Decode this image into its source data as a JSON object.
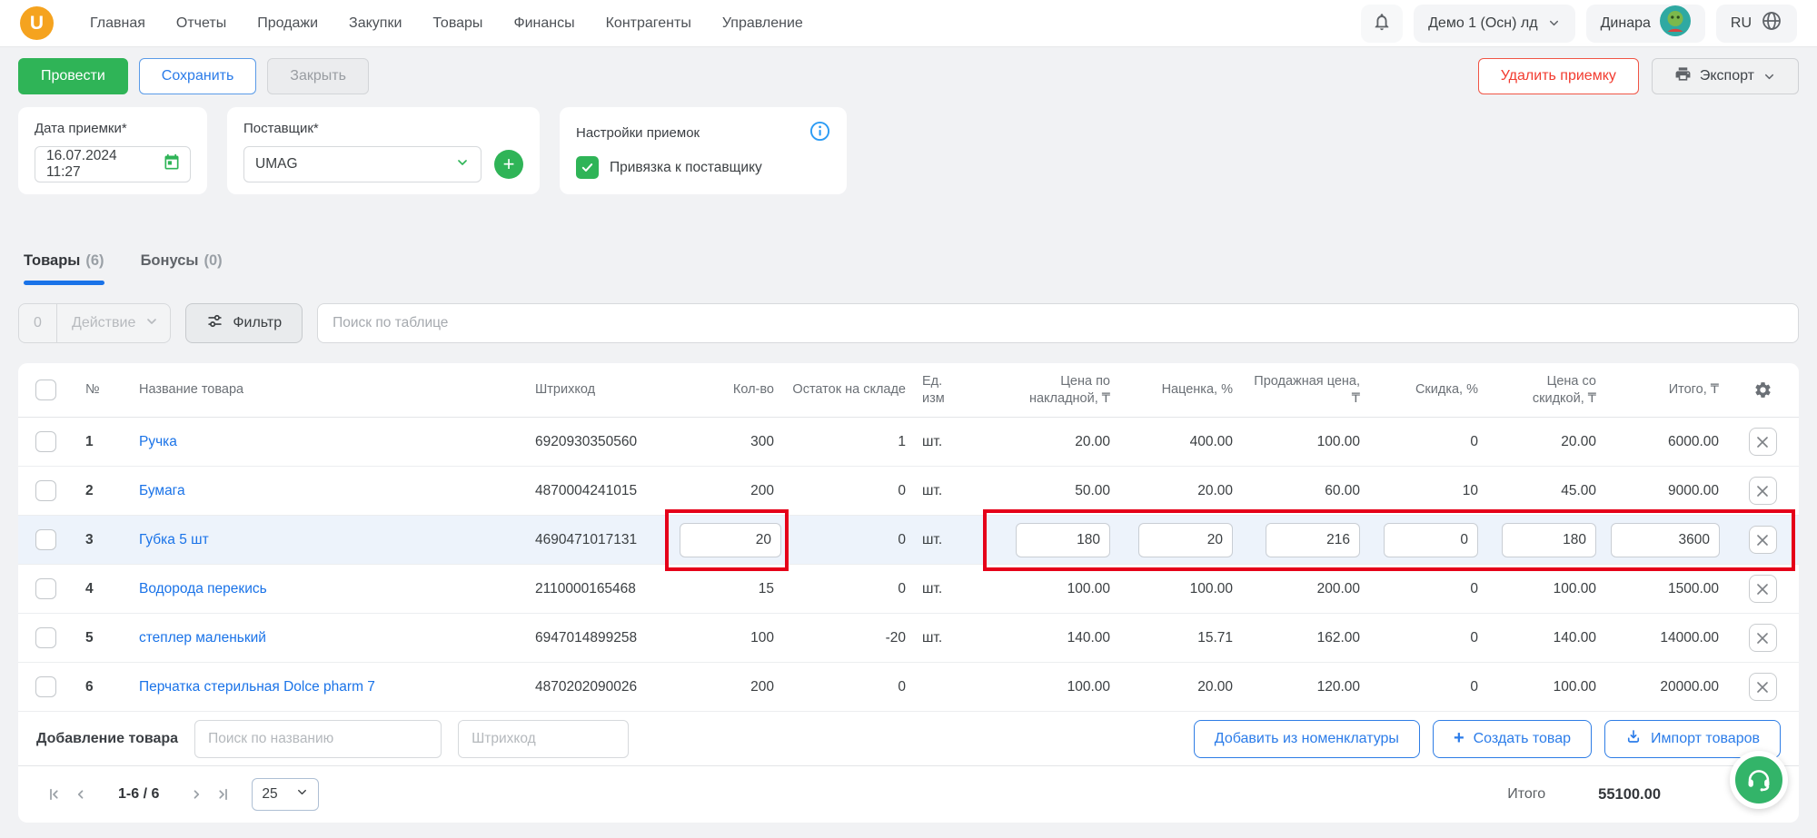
{
  "header": {
    "logo_letter": "U",
    "nav_items": [
      "Главная",
      "Отчеты",
      "Продажи",
      "Закупки",
      "Товары",
      "Финансы",
      "Контрагенты",
      "Управление"
    ],
    "company_selector": "Демо 1 (Осн) лд",
    "user_name": "Динара",
    "language": "RU"
  },
  "action_bar": {
    "post": "Провести",
    "save": "Сохранить",
    "close": "Закрыть",
    "delete": "Удалить приемку",
    "export": "Экспорт"
  },
  "form": {
    "date_label": "Дата приемки*",
    "date_value": "16.07.2024 11:27",
    "supplier_label": "Поставщик*",
    "supplier_value": "UMAG",
    "settings_label": "Настройки приемок",
    "settings_checkbox_label": "Привязка к поставщику",
    "settings_checkbox_checked": true
  },
  "tabs": [
    {
      "label": "Товары",
      "count": "(6)",
      "active": true
    },
    {
      "label": "Бонусы",
      "count": "(0)",
      "active": false
    }
  ],
  "toolbar": {
    "selected_count": "0",
    "action_label": "Действие",
    "filter_label": "Фильтр",
    "search_placeholder": "Поиск по таблице"
  },
  "table": {
    "headers": {
      "num": "№",
      "name": "Название товара",
      "barcode": "Штрихкод",
      "qty": "Кол-во",
      "stock": "Остаток на складе",
      "unit": "Ед. изм",
      "price_invoice": "Цена по накладной, ₸",
      "markup": "Наценка, %",
      "sale_price": "Продажная цена, ₸",
      "discount": "Скидка, %",
      "price_discounted": "Цена со скидкой, ₸",
      "total": "Итого, ₸"
    },
    "rows": [
      {
        "num": "1",
        "name": "Ручка",
        "barcode": "6920930350560",
        "qty": "300",
        "stock": "1",
        "unit": "шт.",
        "price_invoice": "20.00",
        "markup": "400.00",
        "sale_price": "100.00",
        "discount": "0",
        "price_discounted": "20.00",
        "total": "6000.00"
      },
      {
        "num": "2",
        "name": "Бумага",
        "barcode": "4870004241015",
        "qty": "200",
        "stock": "0",
        "unit": "шт.",
        "price_invoice": "50.00",
        "markup": "20.00",
        "sale_price": "60.00",
        "discount": "10",
        "price_discounted": "45.00",
        "total": "9000.00"
      },
      {
        "num": "3",
        "name": "Губка 5 шт",
        "barcode": "4690471017131",
        "qty": "20",
        "stock": "0",
        "unit": "шт.",
        "price_invoice": "180",
        "markup": "20",
        "sale_price": "216",
        "discount": "0",
        "price_discounted": "180",
        "total": "3600"
      },
      {
        "num": "4",
        "name": "Водорода перекись",
        "barcode": "2110000165468",
        "qty": "15",
        "stock": "0",
        "unit": "шт.",
        "price_invoice": "100.00",
        "markup": "100.00",
        "sale_price": "200.00",
        "discount": "0",
        "price_discounted": "100.00",
        "total": "1500.00"
      },
      {
        "num": "5",
        "name": "степлер маленький",
        "barcode": "6947014899258",
        "qty": "100",
        "stock": "-20",
        "unit": "шт.",
        "price_invoice": "140.00",
        "markup": "15.71",
        "sale_price": "162.00",
        "discount": "0",
        "price_discounted": "140.00",
        "total": "14000.00"
      },
      {
        "num": "6",
        "name": "Перчатка стерильная Dolce pharm 7",
        "barcode": "4870202090026",
        "qty": "200",
        "stock": "0",
        "unit": "",
        "price_invoice": "100.00",
        "markup": "20.00",
        "sale_price": "120.00",
        "discount": "0",
        "price_discounted": "100.00",
        "total": "20000.00"
      }
    ],
    "highlighted_row_number": "3"
  },
  "add_product": {
    "label": "Добавление товара",
    "name_placeholder": "Поиск по названию",
    "barcode_placeholder": "Штрихкод",
    "add_from_catalog": "Добавить из номенклатуры",
    "create_product": "Создать товар",
    "import_products": "Импорт товаров"
  },
  "pagination": {
    "range": "1-6 / 6",
    "page_size": "25"
  },
  "summary": {
    "total_label": "Итого",
    "total_value": "55100.00"
  },
  "colors": {
    "accent_green": "#2FB457",
    "accent_blue": "#1a73e8",
    "danger_red": "#F23B2F",
    "annotation_red": "#E50019",
    "row_highlight": "#EDF3FB",
    "logo_orange": "#F5A31F"
  },
  "icons": {
    "notifications": "bell-icon",
    "language": "globe-icon",
    "export": "printer-icon",
    "date": "calendar-icon",
    "supplier_add": "plus-icon",
    "settings_info": "info-icon",
    "filter": "sliders-icon",
    "column_settings": "gear-icon",
    "row_delete": "x-icon",
    "import": "download-icon",
    "support": "headset-icon"
  }
}
